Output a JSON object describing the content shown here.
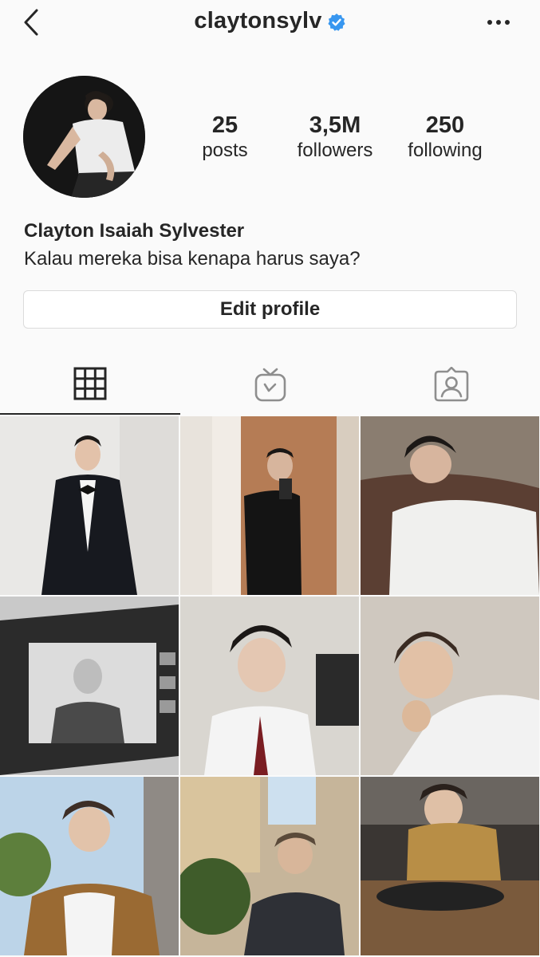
{
  "header": {
    "username": "claytonsylv",
    "back_icon": "chevron-left-icon",
    "verified_icon": "verified-badge-icon",
    "more_icon": "more-horizontal-icon"
  },
  "stats": {
    "posts": {
      "value": "25",
      "label": "posts"
    },
    "followers": {
      "value": "3,5M",
      "label": "followers"
    },
    "following": {
      "value": "250",
      "label": "following"
    }
  },
  "profile": {
    "full_name": "Clayton Isaiah Sylvester",
    "bio": "Kalau mereka bisa kenapa harus saya?",
    "edit_label": "Edit profile"
  },
  "tabs": [
    {
      "name": "posts-grid",
      "icon": "grid-icon",
      "selected": true
    },
    {
      "name": "igtv",
      "icon": "igtv-icon",
      "selected": false
    },
    {
      "name": "tagged",
      "icon": "tagged-user-icon",
      "selected": false
    }
  ],
  "posts": [
    {
      "description": "man in black tuxedo against white wall"
    },
    {
      "description": "mirror selfie in black shirt"
    },
    {
      "description": "man in white t-shirt leaning back"
    },
    {
      "description": "laptop showing black and white photo"
    },
    {
      "description": "man in white shirt and red tie"
    },
    {
      "description": "man resting chin on hand"
    },
    {
      "description": "man in brown jacket outdoors"
    },
    {
      "description": "man sitting at outdoor cafe"
    },
    {
      "description": "man at record player in cafe"
    }
  ],
  "colors": {
    "accent": "#3897f0",
    "text": "#262626",
    "border": "#dbdbdb",
    "background": "#fafafa"
  }
}
